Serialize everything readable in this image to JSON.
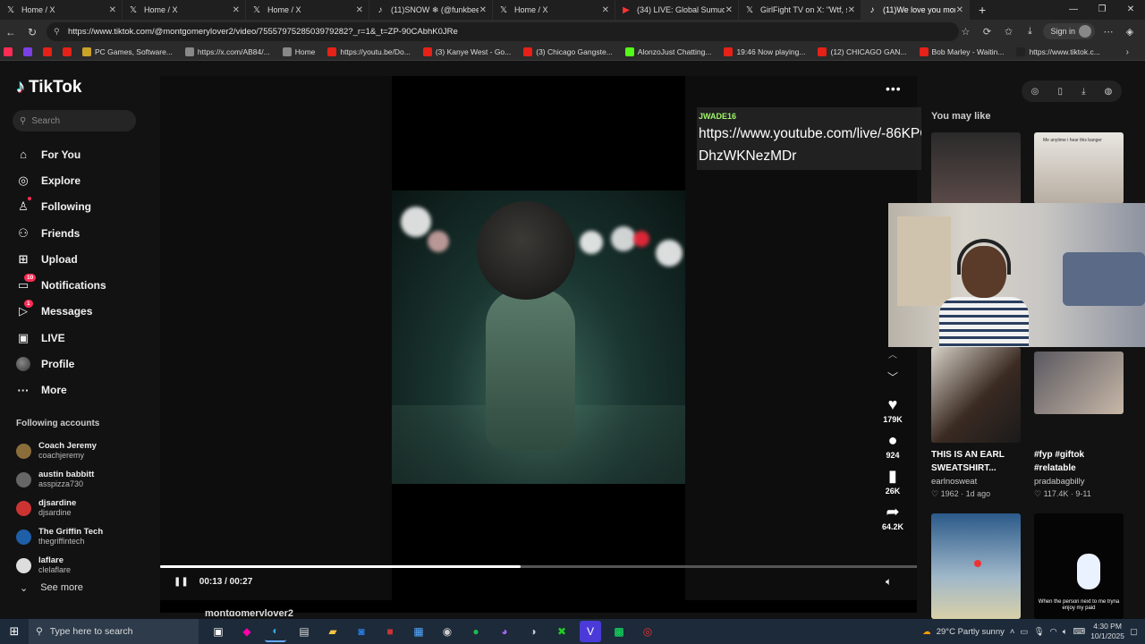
{
  "browser": {
    "tabs": [
      {
        "label": "Home / X",
        "icon": "x-logo-icon",
        "width": 137
      },
      {
        "label": "Home / X",
        "icon": "x-logo-icon",
        "width": 138
      },
      {
        "label": "Home / X",
        "icon": "x-logo-icon",
        "width": 138
      },
      {
        "label": "(11)SNOW ❄ (@funkbee",
        "icon": "tiktok-icon",
        "width": 138
      },
      {
        "label": "Home / X",
        "icon": "x-logo-icon",
        "width": 137
      },
      {
        "label": "(34) LIVE: Global Sumud Flo",
        "icon": "youtube-icon",
        "width": 138
      },
      {
        "label": "GirlFight TV on X: \"Wtf, she",
        "icon": "x-logo-icon",
        "width": 137
      },
      {
        "label": "(11)We love you mon",
        "icon": "tiktok-icon",
        "width": 121,
        "active": true
      }
    ],
    "url": "https://www.tiktok.com/@montgomerylover2/video/7555797528503979282?_r=1&_t=ZP-90CAbhK0JRe",
    "signin_label": "Sign in",
    "bookmarks": [
      {
        "label": "",
        "color": "#fe2c55"
      },
      {
        "label": "",
        "color": "#7b3fe4"
      },
      {
        "label": "",
        "color": "#e62117"
      },
      {
        "label": "",
        "color": "#e62117"
      },
      {
        "label": "PC Games, Software...",
        "color": "#c9a227"
      },
      {
        "label": "https://x.com/AB84/...",
        "color": "#888"
      },
      {
        "label": "Home",
        "color": "#888"
      },
      {
        "label": "https://youtu.be/Do...",
        "color": "#e62117"
      },
      {
        "label": "(3) Kanye West - Go...",
        "color": "#e62117"
      },
      {
        "label": "(3) Chicago Gangste...",
        "color": "#e62117"
      },
      {
        "label": "AlonzoJust Chatting...",
        "color": "#53fc18"
      },
      {
        "label": "19:46 Now playing...",
        "color": "#e62117"
      },
      {
        "label": "(12) CHICAGO GAN...",
        "color": "#e62117"
      },
      {
        "label": "Bob Marley - Waitin...",
        "color": "#e62117"
      },
      {
        "label": "https://www.tiktok.c...",
        "color": "#222"
      }
    ]
  },
  "sidebar": {
    "logo_text": "TikTok",
    "search_placeholder": "Search",
    "nav": [
      {
        "label": "For You",
        "icon": "home-icon",
        "glyph": "⌂"
      },
      {
        "label": "Explore",
        "icon": "compass-icon",
        "glyph": "◎"
      },
      {
        "label": "Following",
        "icon": "following-icon",
        "glyph": "♙",
        "dot": true
      },
      {
        "label": "Friends",
        "icon": "friends-icon",
        "glyph": "⚇"
      },
      {
        "label": "Upload",
        "icon": "upload-icon",
        "glyph": "⊞"
      },
      {
        "label": "Notifications",
        "icon": "inbox-icon",
        "glyph": "▭",
        "badge": "10"
      },
      {
        "label": "Messages",
        "icon": "messages-icon",
        "glyph": "▷",
        "badge": "1"
      },
      {
        "label": "LIVE",
        "icon": "live-icon",
        "glyph": "▣"
      },
      {
        "label": "Profile",
        "icon": "profile-avatar-icon",
        "glyph": ""
      },
      {
        "label": "More",
        "icon": "more-icon",
        "glyph": "···"
      }
    ],
    "following_title": "Following accounts",
    "following": [
      {
        "name": "Coach Jeremy",
        "user": "coachjeremy",
        "color": "#8a6d3b"
      },
      {
        "name": "austin babbitt",
        "user": "asspizza730",
        "color": "#666"
      },
      {
        "name": "djsardine",
        "user": "djsardine",
        "color": "#c33"
      },
      {
        "name": "The Griffin Tech",
        "user": "thegriffintech",
        "color": "#1f5fa8"
      },
      {
        "name": "laflare",
        "user": "clelaflare",
        "color": "#ddd"
      }
    ],
    "see_more": "See more"
  },
  "video": {
    "overlay_user": "JWADE16",
    "overlay_text": "https://www.youtube.com/live/-86KPCACLZc?si=_hfW5DhzWKNezMDr",
    "time": "00:13 / 00:27",
    "progress": 0.476,
    "author_partial": "montgomerylover2",
    "actions": [
      {
        "icon": "heart-icon",
        "glyph": "♥",
        "count": "179K"
      },
      {
        "icon": "comment-icon",
        "glyph": "●",
        "count": "924"
      },
      {
        "icon": "bookmark-icon",
        "glyph": "▮",
        "count": "26K"
      },
      {
        "icon": "share-icon",
        "glyph": "➦",
        "count": "64.2K"
      }
    ]
  },
  "right_panel": {
    "title": "You may like",
    "cards": [
      {
        "caption1": "THIS IS AN EARL",
        "caption2": "SWEATSHIRT...",
        "user": "earlnosweat",
        "meta": "♡ 1962 · 1d ago"
      },
      {
        "caption1": "#fyp #giftok",
        "caption2": "#relatable",
        "user": "pradabagbilly",
        "meta": "♡ 117.4K · 9-11"
      }
    ],
    "thumb_caption_top": "Me anytime i hear this banger",
    "thumb_caption_bottom": "When the person next to me tryna enjoy my paid"
  },
  "taskbar": {
    "search_placeholder": "Type here to search",
    "weather": "29°C  Partly sunny",
    "time": "4:30 PM",
    "date": "10/1/2025"
  }
}
